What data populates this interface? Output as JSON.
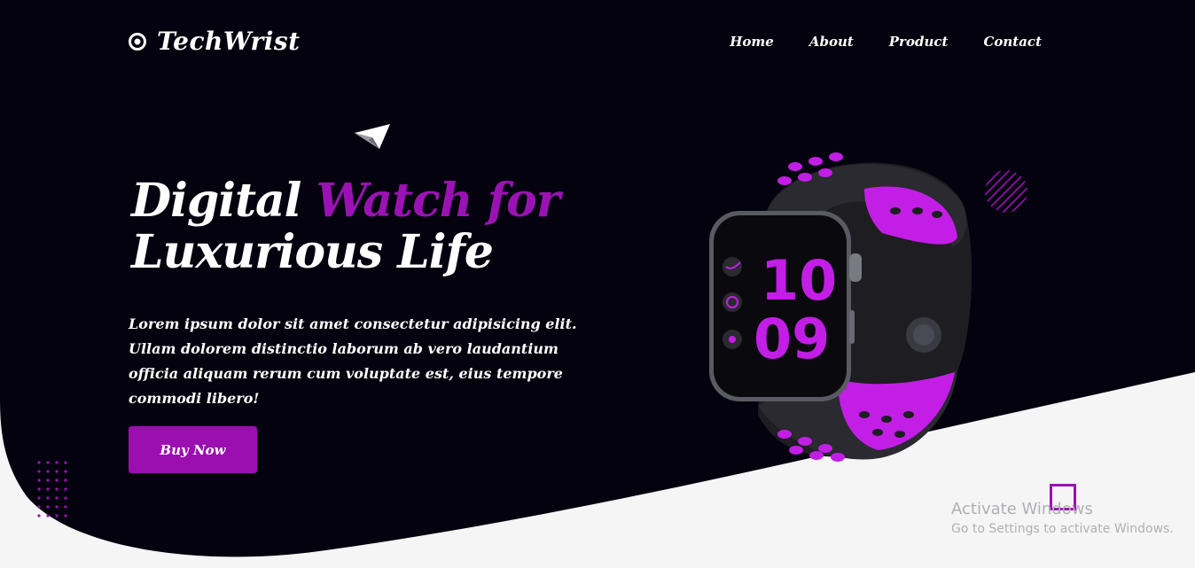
{
  "brand": {
    "name": "TechWrist"
  },
  "nav": {
    "home": "Home",
    "about": "About",
    "product": "Product",
    "contact": "Contact"
  },
  "hero": {
    "title_part1": "Digital ",
    "title_accent": "Watch for",
    "title_part2": "Luxurious Life",
    "description": "Lorem ipsum dolor sit amet consectetur adipisicing elit. Ullam dolorem distinctio laborum ab vero laudantium officia aliquam rerum cum voluptate est, eius tempore commodi libero!",
    "buy_label": "Buy Now"
  },
  "watch": {
    "hour": "10",
    "minute": "09"
  },
  "overlay": {
    "activate_title": "Activate Windows",
    "activate_sub": "Go to Settings to activate Windows."
  },
  "colors": {
    "dark_bg": "#04020e",
    "accent": "#9b12b4",
    "light_bg": "#f5f5f6",
    "watch_band_accent": "#c31ee6"
  },
  "icons": [
    "target-logo-icon",
    "paper-plane-icon",
    "striped-circle-icon",
    "dot-grid-icon",
    "square-outline-icon"
  ]
}
